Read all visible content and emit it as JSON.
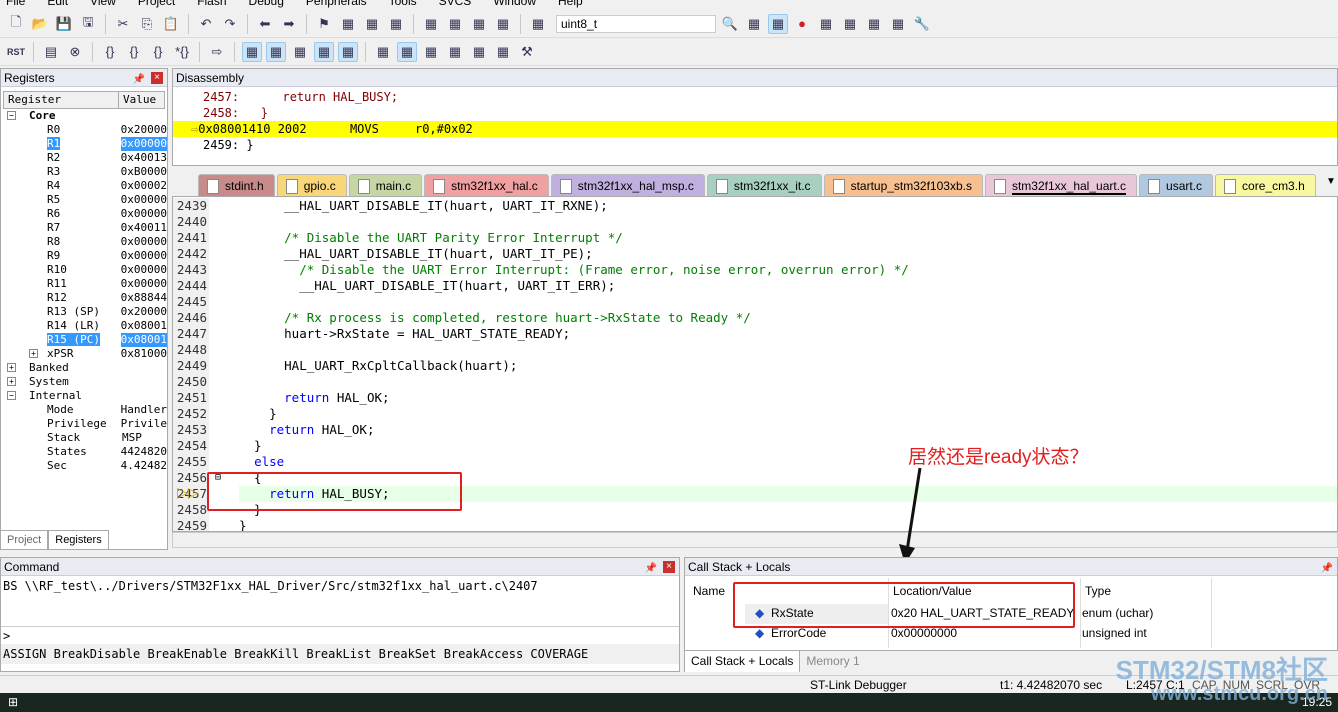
{
  "menu": [
    "File",
    "Edit",
    "View",
    "Project",
    "Flash",
    "Debug",
    "Peripherals",
    "Tools",
    "SVCS",
    "Window",
    "Help"
  ],
  "toolbar1": {
    "icons": [
      "new-file",
      "open",
      "save",
      "save-all",
      "cut",
      "copy",
      "paste",
      "undo",
      "redo",
      "nav-back",
      "nav-forward",
      "bookmark",
      "prev-bookmark",
      "next-bookmark",
      "clear-bookmarks",
      "indent",
      "unindent",
      "comment",
      "uncomment",
      "find-in-files"
    ],
    "find_value": "uint8_t",
    "right_icons": [
      "find",
      "incremental-find",
      "debug-session",
      "breakpoint",
      "disable-breakpoint",
      "kill-breakpoints",
      "clear-breakpoints",
      "window-layout",
      "configure"
    ]
  },
  "toolbar2": {
    "rst_label": "RST",
    "icons": [
      "reset",
      "run",
      "stop",
      "step-into",
      "step-over",
      "step-out",
      "run-to-cursor",
      "show-next-statement",
      "command-window",
      "disassembly-window",
      "symbols-window",
      "registers-window",
      "call-stack-window",
      "watch-window",
      "memory-window",
      "serial-window",
      "analysis-window",
      "trace-window",
      "system-viewer",
      "toolbox"
    ]
  },
  "registers": {
    "title": "Registers",
    "col_register": "Register",
    "col_value": "Value",
    "rows": [
      {
        "name": "Core",
        "value": "",
        "level": 0,
        "exp": "−",
        "bold": true
      },
      {
        "name": "R0",
        "value": "0x20000",
        "level": 1
      },
      {
        "name": "R1",
        "value": "0x00000",
        "level": 1,
        "sel": true
      },
      {
        "name": "R2",
        "value": "0x40013",
        "level": 1
      },
      {
        "name": "R3",
        "value": "0xB0000",
        "level": 1
      },
      {
        "name": "R4",
        "value": "0x00002",
        "level": 1
      },
      {
        "name": "R5",
        "value": "0x00000",
        "level": 1
      },
      {
        "name": "R6",
        "value": "0x00000",
        "level": 1
      },
      {
        "name": "R7",
        "value": "0x40011",
        "level": 1
      },
      {
        "name": "R8",
        "value": "0x00000",
        "level": 1
      },
      {
        "name": "R9",
        "value": "0x00000",
        "level": 1
      },
      {
        "name": "R10",
        "value": "0x00000",
        "level": 1
      },
      {
        "name": "R11",
        "value": "0x00000",
        "level": 1
      },
      {
        "name": "R12",
        "value": "0x88844",
        "level": 1
      },
      {
        "name": "R13 (SP)",
        "value": "0x20000",
        "level": 1
      },
      {
        "name": "R14 (LR)",
        "value": "0x08001",
        "level": 1
      },
      {
        "name": "R15 (PC)",
        "value": "0x08001",
        "level": 1,
        "sel": true
      },
      {
        "name": "xPSR",
        "value": "0x81000",
        "level": 1,
        "exp": "+"
      },
      {
        "name": "Banked",
        "value": "",
        "level": 0,
        "exp": "+"
      },
      {
        "name": "System",
        "value": "",
        "level": 0,
        "exp": "+"
      },
      {
        "name": "Internal",
        "value": "",
        "level": 0,
        "exp": "−"
      },
      {
        "name": "Mode",
        "value": "Handler",
        "level": 1
      },
      {
        "name": "Privilege",
        "value": "Privile",
        "level": 1
      },
      {
        "name": "Stack",
        "value": "MSP",
        "level": 1
      },
      {
        "name": "States",
        "value": "4424820",
        "level": 1
      },
      {
        "name": "Sec",
        "value": "4.42482",
        "level": 1
      }
    ],
    "tabs": [
      "Project",
      "Registers"
    ]
  },
  "disassembly": {
    "title": "Disassembly",
    "lines": [
      {
        "text": "2457:      return HAL_BUSY;",
        "cur": false
      },
      {
        "text": "2458:   }",
        "cur": false
      },
      {
        "text": "0x08001410 2002      MOVS     r0,#0x02",
        "cur": true
      },
      {
        "text": "2459: }",
        "cur": false
      }
    ]
  },
  "file_tabs": [
    {
      "name": "stdint.h",
      "color": "#c98a8a"
    },
    {
      "name": "gpio.c",
      "color": "#f7d77a"
    },
    {
      "name": "main.c",
      "color": "#c5d6a4"
    },
    {
      "name": "stm32f1xx_hal.c",
      "color": "#f0a0a0"
    },
    {
      "name": "stm32f1xx_hal_msp.c",
      "color": "#c0b0e0"
    },
    {
      "name": "stm32f1xx_it.c",
      "color": "#a8d0c0"
    },
    {
      "name": "startup_stm32f103xb.s",
      "color": "#f7c090"
    },
    {
      "name": "stm32f1xx_hal_uart.c",
      "color": "#e8c8d8",
      "active": true
    },
    {
      "name": "usart.c",
      "color": "#b0c8e0"
    },
    {
      "name": "core_cm3.h",
      "color": "#f8f8a0"
    }
  ],
  "code": [
    {
      "n": "2439",
      "s": [
        [
          "",
          "      __HAL_UART_DISABLE_IT(huart, UART_IT_RXNE);"
        ]
      ]
    },
    {
      "n": "2440",
      "s": []
    },
    {
      "n": "2441",
      "s": [
        [
          "cm",
          "      /* Disable the UART Parity Error Interrupt */"
        ]
      ]
    },
    {
      "n": "2442",
      "s": [
        [
          "",
          "      __HAL_UART_DISABLE_IT(huart, UART_IT_PE);"
        ]
      ]
    },
    {
      "n": "2443",
      "s": [
        [
          "cm",
          "        /* Disable the UART Error Interrupt: (Frame error, noise error, overrun error) */"
        ]
      ]
    },
    {
      "n": "2444",
      "s": [
        [
          "",
          "        __HAL_UART_DISABLE_IT(huart, UART_IT_ERR);"
        ]
      ]
    },
    {
      "n": "2445",
      "s": []
    },
    {
      "n": "2446",
      "s": [
        [
          "cm",
          "      /* Rx process is completed, restore huart->RxState to Ready */"
        ]
      ]
    },
    {
      "n": "2447",
      "s": [
        [
          "",
          "      huart->RxState = HAL_UART_STATE_READY;"
        ]
      ]
    },
    {
      "n": "2448",
      "s": []
    },
    {
      "n": "2449",
      "s": [
        [
          "",
          "      HAL_UART_RxCpltCallback(huart);"
        ]
      ]
    },
    {
      "n": "2450",
      "s": []
    },
    {
      "n": "2451",
      "s": [
        [
          "",
          "      "
        ],
        [
          "kw",
          "return"
        ],
        [
          "",
          " HAL_OK;"
        ]
      ]
    },
    {
      "n": "2452",
      "s": [
        [
          "",
          "    }"
        ]
      ]
    },
    {
      "n": "2453",
      "s": [
        [
          "",
          "    "
        ],
        [
          "kw",
          "return"
        ],
        [
          "",
          " HAL_OK;"
        ]
      ]
    },
    {
      "n": "2454",
      "s": [
        [
          "",
          "  }"
        ]
      ]
    },
    {
      "n": "2455",
      "s": [
        [
          "",
          "  "
        ],
        [
          "kw",
          "else"
        ]
      ]
    },
    {
      "n": "2456",
      "s": [
        [
          "",
          "  {"
        ]
      ]
    },
    {
      "n": "2457",
      "s": [
        [
          "",
          "    "
        ],
        [
          "kw",
          "return"
        ],
        [
          "",
          " HAL_BUSY;"
        ]
      ],
      "cur": true
    },
    {
      "n": "2458",
      "s": [
        [
          "",
          "  }"
        ]
      ]
    },
    {
      "n": "2459",
      "s": [
        [
          "",
          "}"
        ]
      ]
    }
  ],
  "annotation": "居然还是ready状态？",
  "command": {
    "title": "Command",
    "output": "BS \\\\RF_test\\../Drivers/STM32F1xx_HAL_Driver/Src/stm32f1xx_hal_uart.c\\2407",
    "prompt": ">",
    "hints": "ASSIGN BreakDisable BreakEnable BreakKill BreakList BreakSet BreakAccess COVERAGE"
  },
  "callstack": {
    "title": "Call Stack + Locals",
    "cols": [
      "Name",
      "Location/Value",
      "Type"
    ],
    "rows": [
      {
        "name": "RxState",
        "value": "0x20 HAL_UART_STATE_READY",
        "type": "enum (uchar)"
      },
      {
        "name": "ErrorCode",
        "value": "0x00000000",
        "type": "unsigned int"
      }
    ],
    "tabs": [
      "Call Stack + Locals",
      "Memory 1"
    ]
  },
  "status": {
    "debugger": "ST-Link Debugger",
    "time": "t1: 4.42482070 sec",
    "pos": "L:2457 C:1",
    "flags": [
      "CAP",
      "NUM",
      "SCRL",
      "OVR"
    ]
  },
  "taskbar": {
    "clock": "19:25"
  },
  "watermark": {
    "line1": "STM32/STM8社区",
    "line2": "www.stmcu.org.cn"
  },
  "colors": {
    "current_line": "#ffff00",
    "highlight": "#e6ffe6",
    "selection": "#3399ff",
    "annotation": "#e02020"
  }
}
